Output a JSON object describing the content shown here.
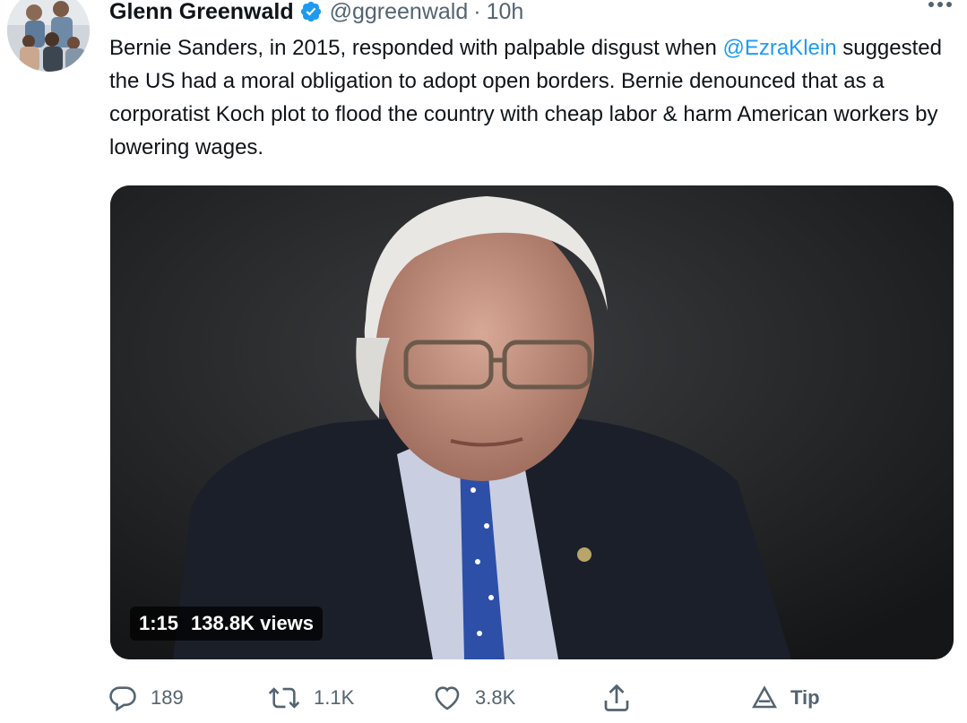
{
  "tweet": {
    "author_name": "Glenn Greenwald",
    "handle": "@ggreenwald",
    "separator": "·",
    "time": "10h",
    "text_before_mention": "Bernie Sanders, in 2015, responded with palpable disgust when ",
    "mention": "@EzraKlein",
    "text_after_mention": " suggested the US had a moral obligation to adopt open borders. Bernie denounced that as a corporatist Koch plot to flood the country with cheap labor & harm American workers by lowering wages."
  },
  "video": {
    "duration": "1:15",
    "views": "138.8K views"
  },
  "actions": {
    "reply_count": "189",
    "retweet_count": "1.1K",
    "like_count": "3.8K",
    "tip_label": "Tip"
  },
  "icons": {
    "verified": "verified-badge-icon",
    "more": "more-dots-icon",
    "reply": "reply-bubble-icon",
    "retweet": "retweet-arrows-icon",
    "like": "heart-icon",
    "share": "share-upload-icon",
    "tip": "tip-triangle-icon"
  },
  "colors": {
    "accent": "#1d9bf0",
    "muted": "#536471",
    "text": "#0f1419"
  }
}
